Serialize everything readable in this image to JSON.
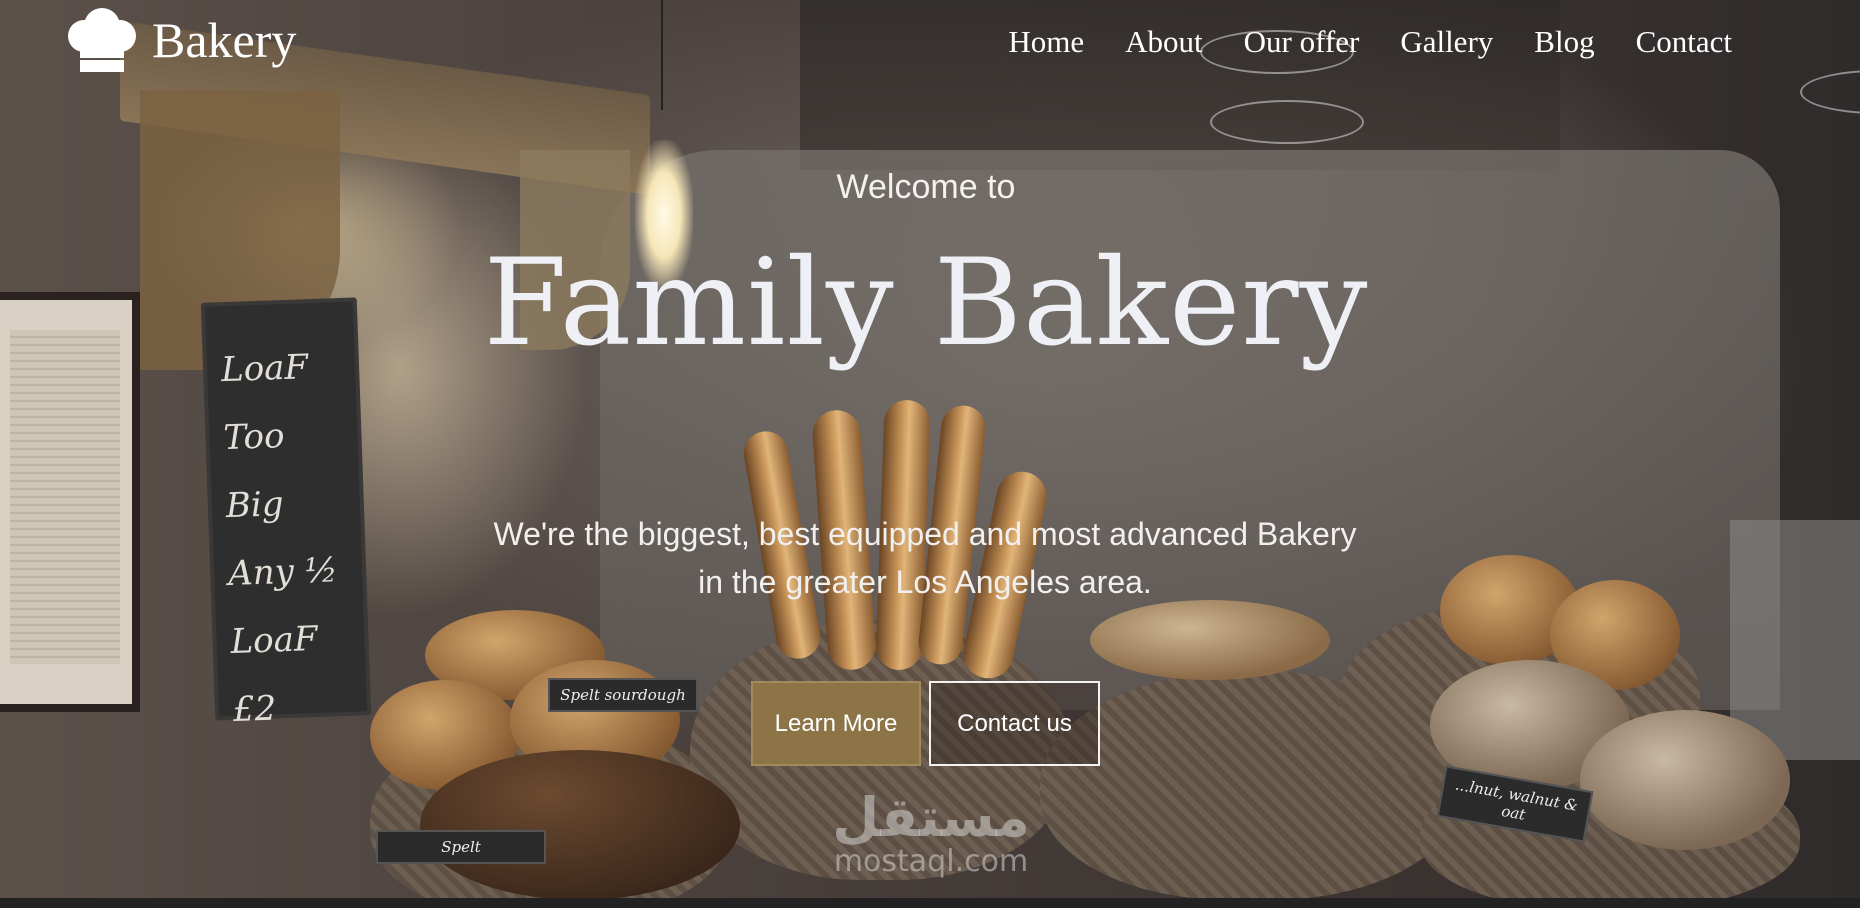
{
  "brand": {
    "name": "Bakery",
    "icon": "chef-hat-icon"
  },
  "nav": {
    "items": [
      {
        "label": "Home"
      },
      {
        "label": "About"
      },
      {
        "label": "Our offer"
      },
      {
        "label": "Gallery"
      },
      {
        "label": "Blog"
      },
      {
        "label": "Contact"
      }
    ]
  },
  "hero": {
    "welcome": "Welcome to",
    "title": "Family Bakery",
    "tagline": "We're the biggest, best equipped and most advanced Bakery in the greater Los Angeles area.",
    "primary_button": "Learn More",
    "secondary_button": "Contact us"
  },
  "scene": {
    "chalkboard": [
      "LoaF Too",
      "Big",
      "Any ½",
      "LoaF £2"
    ],
    "tags": [
      "Spelt sourdough",
      "Spelt",
      "...lnut, walnut & oat"
    ]
  },
  "watermark": {
    "arabic": "مستقل",
    "latin": "mostaql.com"
  },
  "colors": {
    "accent": "#8c7447",
    "text": "#ffffff",
    "title": "#eef0f6"
  }
}
